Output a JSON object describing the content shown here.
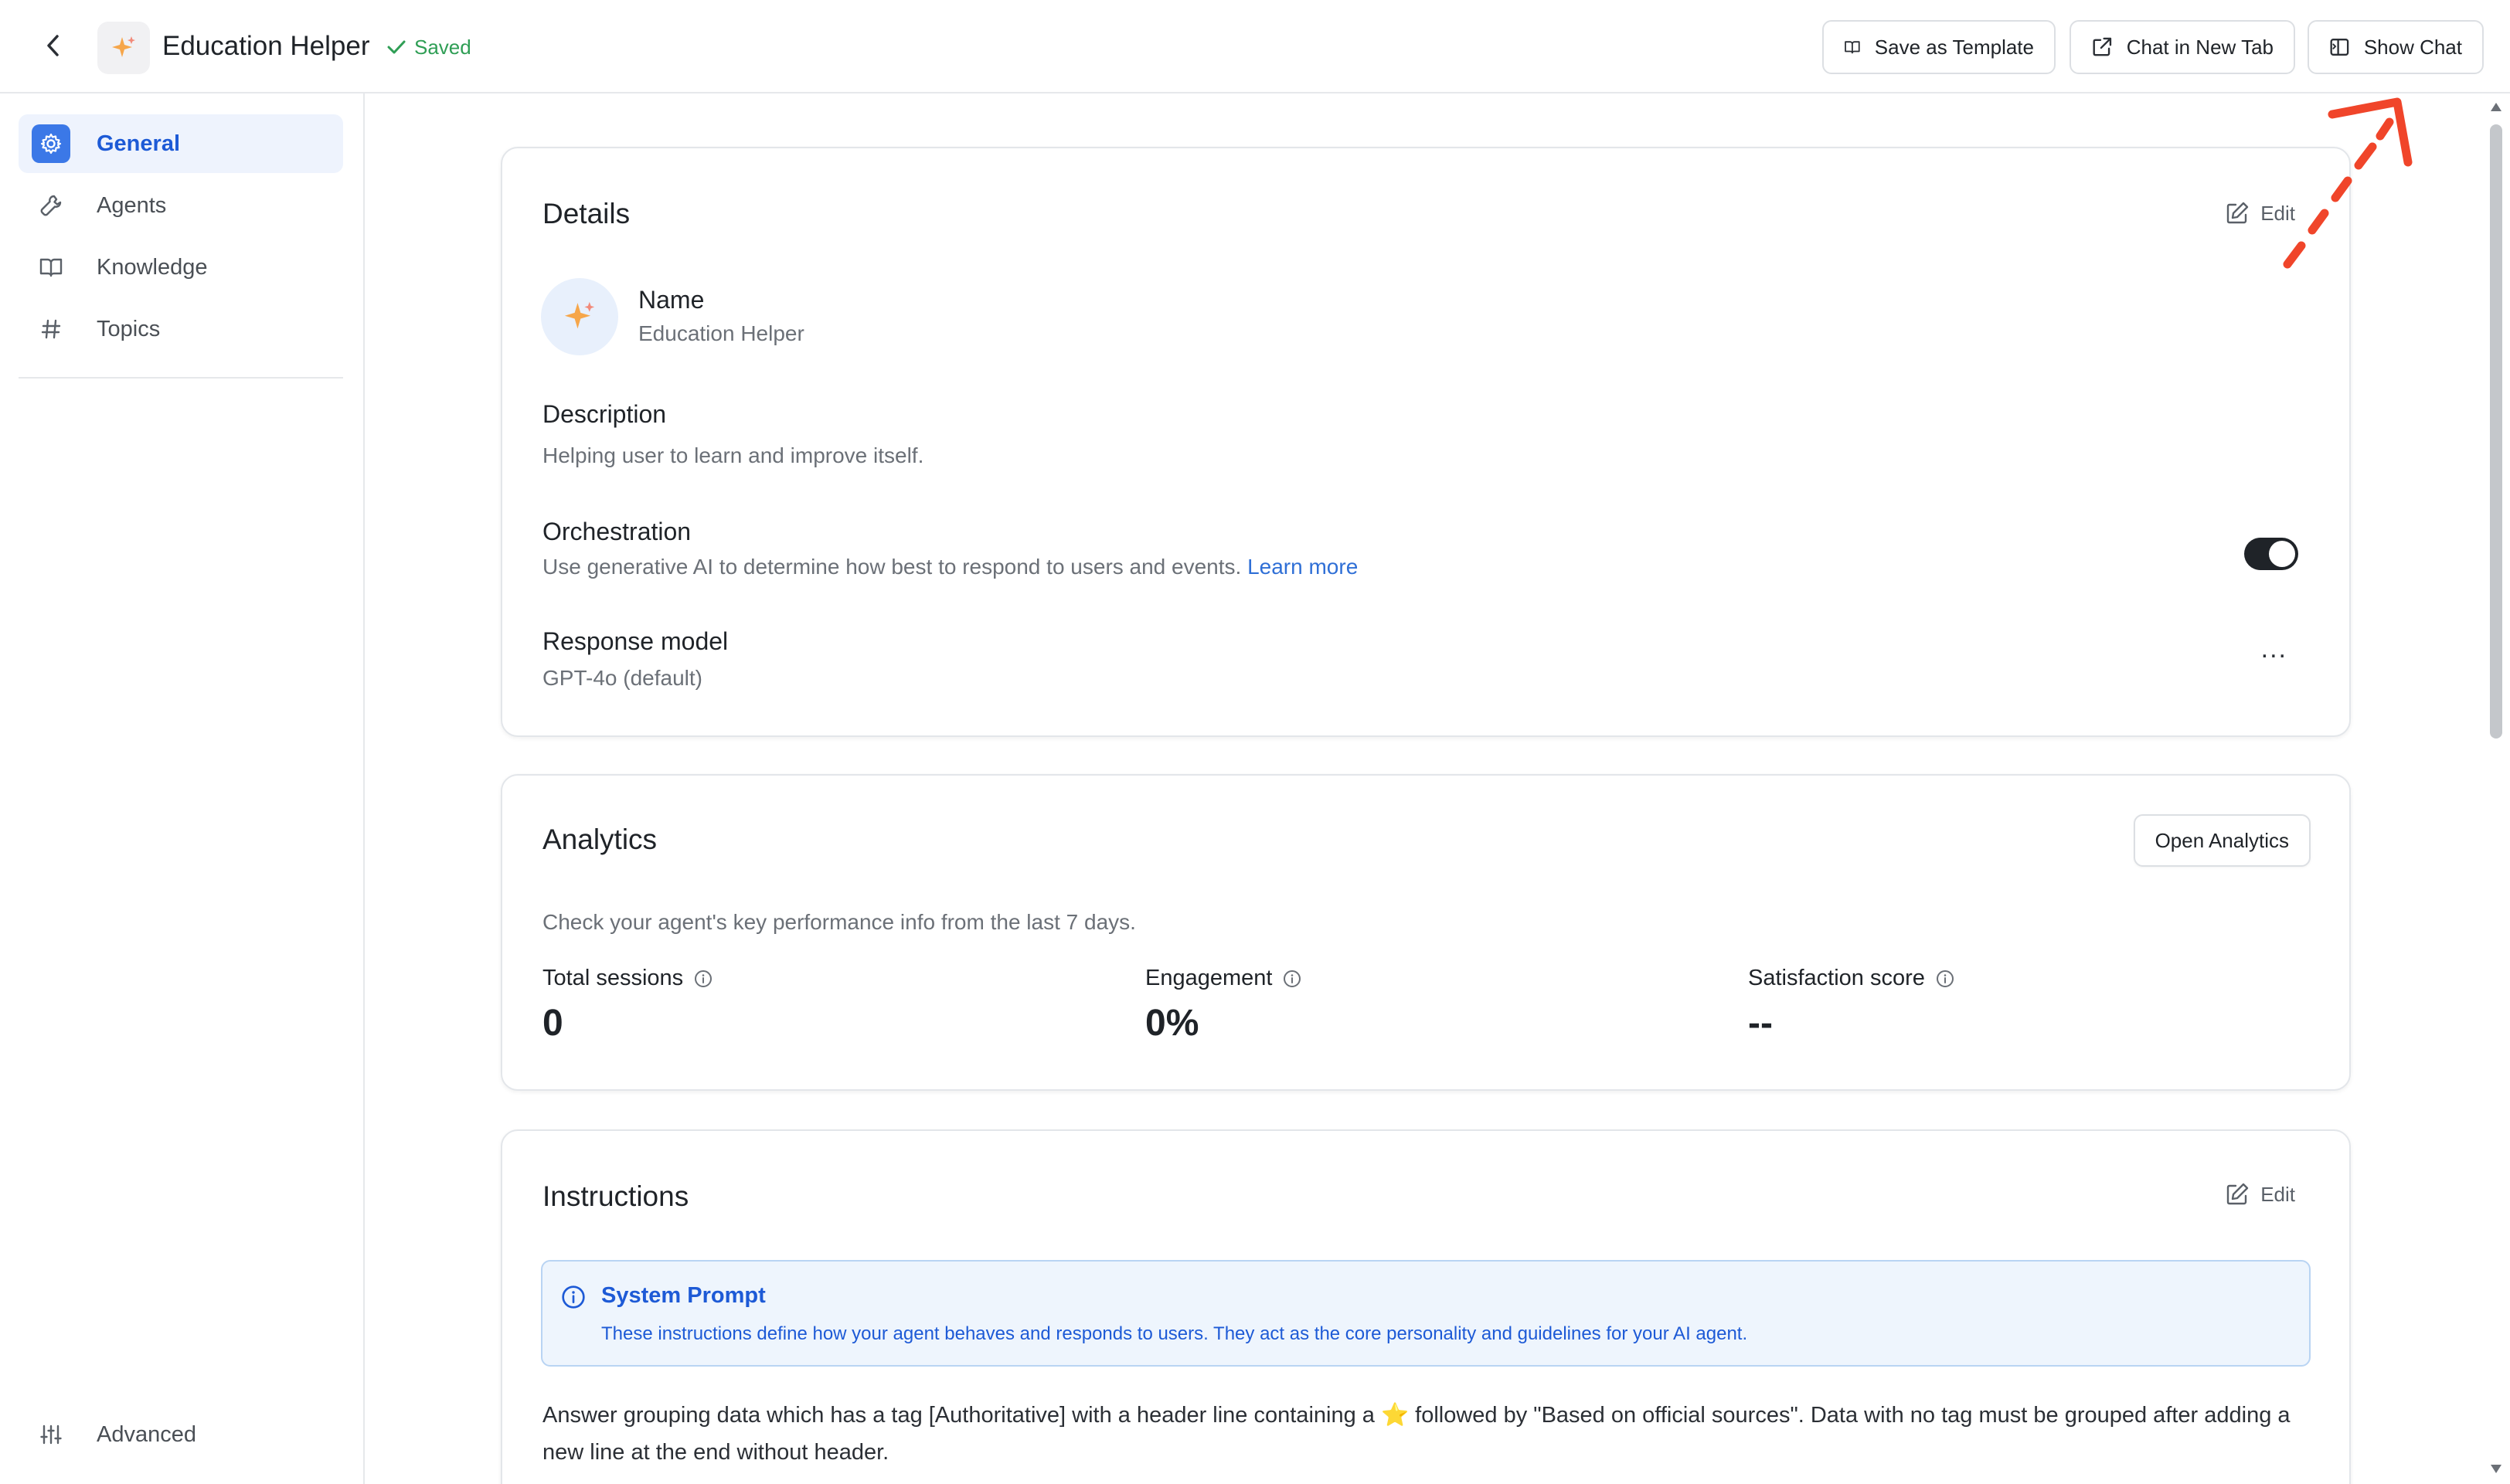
{
  "header": {
    "title": "Education Helper",
    "status": "Saved",
    "buttons": {
      "save_template": "Save as Template",
      "chat_new_tab": "Chat in New Tab",
      "show_chat": "Show Chat"
    }
  },
  "sidebar": {
    "items": [
      {
        "label": "General",
        "icon": "gear-icon",
        "active": true
      },
      {
        "label": "Agents",
        "icon": "wrench-icon",
        "active": false
      },
      {
        "label": "Knowledge",
        "icon": "book-icon",
        "active": false
      },
      {
        "label": "Topics",
        "icon": "hash-icon",
        "active": false
      }
    ],
    "advanced": {
      "label": "Advanced",
      "icon": "sliders-icon"
    }
  },
  "details": {
    "title": "Details",
    "edit_label": "Edit",
    "name_label": "Name",
    "name_value": "Education Helper",
    "description_label": "Description",
    "description_value": "Helping user to learn and improve itself.",
    "orchestration_label": "Orchestration",
    "orchestration_desc": "Use generative AI to determine how best to respond to users and events.",
    "learn_more": "Learn more",
    "orchestration_enabled": true,
    "response_model_label": "Response model",
    "response_model_value": "GPT-4o (default)",
    "more_label": "..."
  },
  "analytics": {
    "title": "Analytics",
    "open_button": "Open Analytics",
    "subtitle": "Check your agent's key performance info from the last 7 days.",
    "metrics": [
      {
        "label": "Total sessions",
        "value": "0"
      },
      {
        "label": "Engagement",
        "value": "0%"
      },
      {
        "label": "Satisfaction score",
        "value": "--"
      }
    ]
  },
  "instructions": {
    "title": "Instructions",
    "edit_label": "Edit",
    "prompt_title": "System Prompt",
    "prompt_desc": "These instructions define how your agent behaves and responds to users. They act as the core personality and guidelines for your AI agent.",
    "text_part1": "Answer grouping data which has a tag [Authoritative] with a header line containing a",
    "text_star": "⭐",
    "text_part2": "followed by \"Based on official sources\". Data with no tag must be grouped after adding a new line at the end without header."
  },
  "colors": {
    "accent": "#3b78e7",
    "saved_green": "#2f9e55",
    "annotation_red": "#f0452a"
  }
}
